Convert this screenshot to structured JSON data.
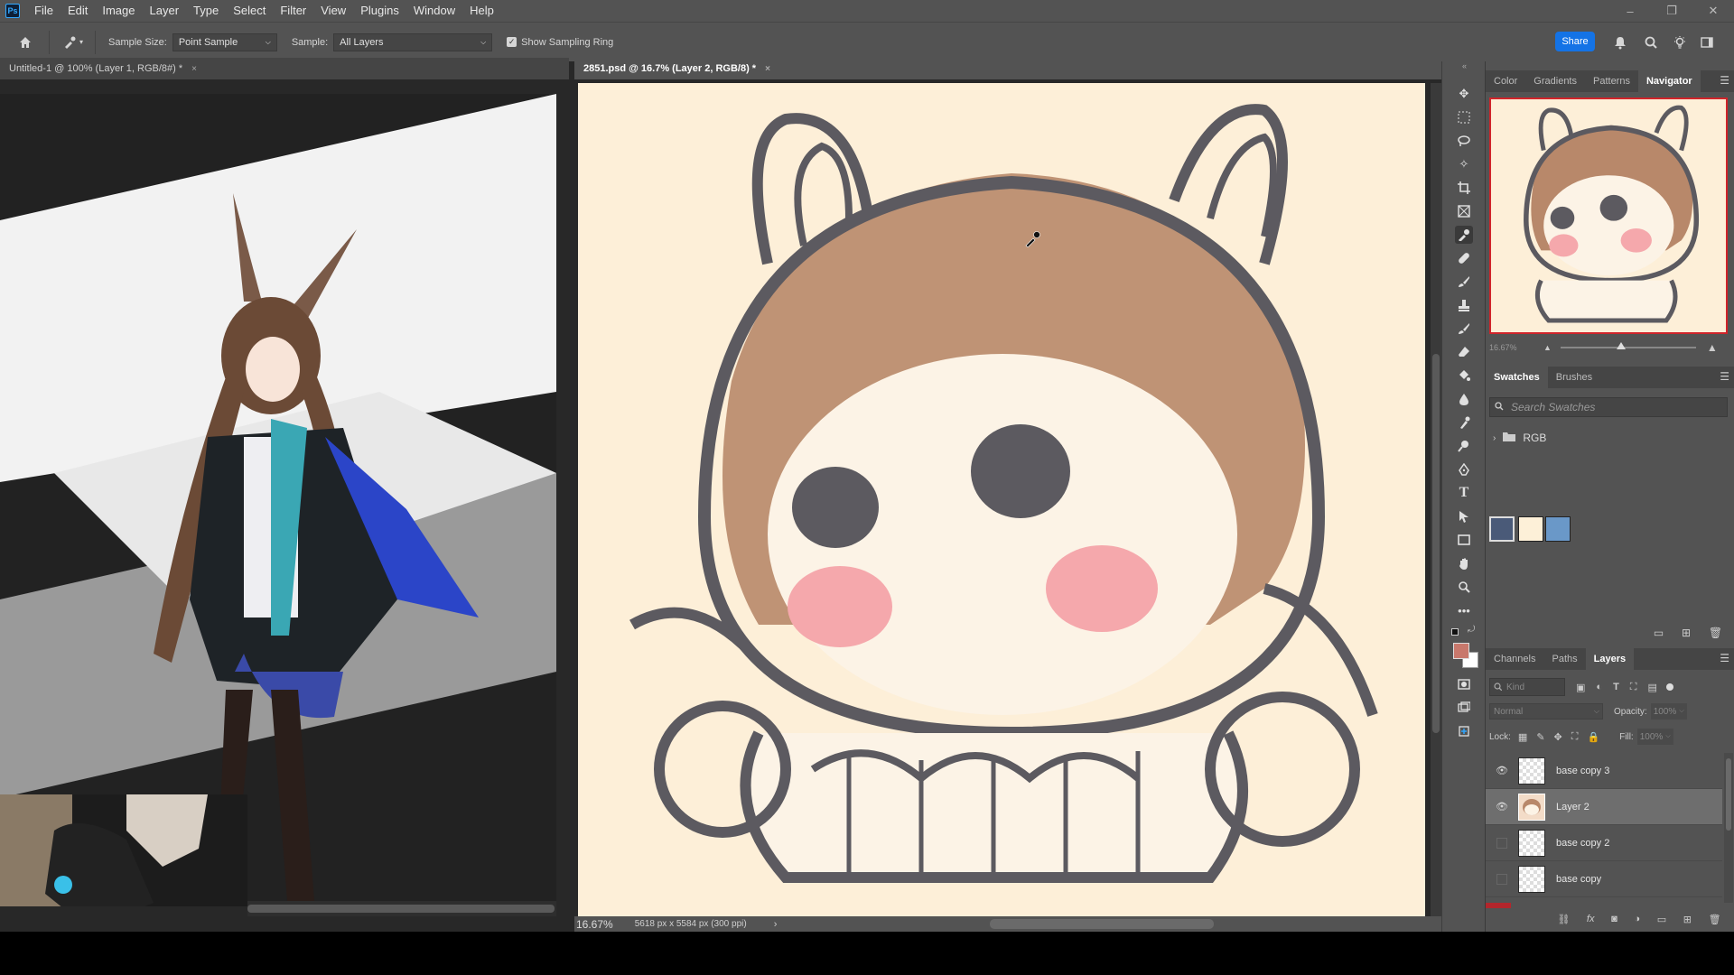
{
  "app": {
    "logo": "Ps",
    "menu": [
      "File",
      "Edit",
      "Image",
      "Layer",
      "Type",
      "Select",
      "Filter",
      "View",
      "Plugins",
      "Window",
      "Help"
    ],
    "window_controls": [
      "–",
      "❐",
      "✕"
    ]
  },
  "options": {
    "sample_size_label": "Sample Size:",
    "sample_size_value": "Point Sample",
    "sample_label": "Sample:",
    "sample_value": "All Layers",
    "show_sampling_ring": "Show Sampling Ring",
    "share": "Share"
  },
  "documents": [
    {
      "title": "Untitled-1 @ 100% (Layer 1, RGB/8#) *",
      "close": "×"
    },
    {
      "title": "2851.psd @ 16.7% (Layer 2, RGB/8) *",
      "close": "×"
    }
  ],
  "status": {
    "zoom": "16.67%",
    "dimensions": "5618 px x 5584 px (300 ppi)",
    "arrow": "›"
  },
  "navigator": {
    "tabs": [
      "Color",
      "Gradients",
      "Patterns",
      "Navigator"
    ],
    "active_tab": "Navigator",
    "zoom": "16.67%",
    "slider_position": 0.45
  },
  "swatches": {
    "tabs": [
      "Swatches",
      "Brushes"
    ],
    "search_placeholder": "Search Swatches",
    "group": "RGB",
    "colors": [
      "#4a5a78",
      "#fdf0d8",
      "#6a98c8"
    ]
  },
  "layers_panel": {
    "tabs": [
      "Channels",
      "Paths",
      "Layers"
    ],
    "filter": "Kind",
    "blend_mode": "Normal",
    "opacity_label": "Opacity:",
    "opacity_value": "100%",
    "lock_label": "Lock:",
    "fill_label": "Fill:",
    "fill_value": "100%",
    "layers": [
      {
        "name": "base copy 3",
        "visible": true,
        "selected": false
      },
      {
        "name": "Layer 2",
        "visible": true,
        "selected": true
      },
      {
        "name": "base copy 2",
        "visible": false,
        "selected": false
      },
      {
        "name": "base copy",
        "visible": false,
        "selected": false
      }
    ]
  },
  "colors": {
    "accent": "#1473e6",
    "foreground": "#c8786c",
    "background": "#ffffff",
    "canvas_bg": "#fdefd8"
  },
  "tools": [
    "move-icon",
    "marquee-icon",
    "lasso-icon",
    "magic-wand-icon",
    "crop-icon",
    "frame-icon",
    "eyedropper-icon",
    "healing-icon",
    "brush-icon",
    "stamp-icon",
    "history-brush-icon",
    "eraser-icon",
    "paint-bucket-icon",
    "blur-icon",
    "smudge-icon",
    "dodge-icon",
    "pen-icon",
    "type-icon",
    "path-select-icon",
    "rectangle-icon",
    "hand-icon",
    "zoom-icon",
    "more-icon"
  ]
}
